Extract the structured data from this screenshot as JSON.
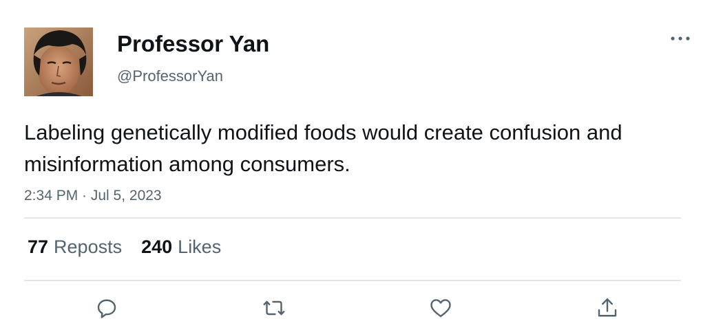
{
  "author": {
    "display_name": "Professor Yan",
    "handle": "@ProfessorYan",
    "avatar_icon": "profile-photo"
  },
  "tweet": {
    "text": "Labeling genetically modified foods would create confusion and misinformation among consumers.",
    "timestamp": "2:34 PM · Jul 5, 2023"
  },
  "stats": {
    "reposts_count": "77",
    "reposts_label": "Reposts",
    "likes_count": "240",
    "likes_label": "Likes"
  },
  "actions": [
    {
      "name": "reply",
      "icon": "speech-bubble-icon"
    },
    {
      "name": "repost",
      "icon": "repost-arrows-icon"
    },
    {
      "name": "like",
      "icon": "heart-icon"
    },
    {
      "name": "share",
      "icon": "share-upload-icon"
    }
  ],
  "menu": {
    "icon": "more-dots-icon"
  },
  "colors": {
    "text_primary": "#0f1419",
    "text_secondary": "#536471",
    "divider": "#e1e5e8",
    "icon": "#536471"
  }
}
